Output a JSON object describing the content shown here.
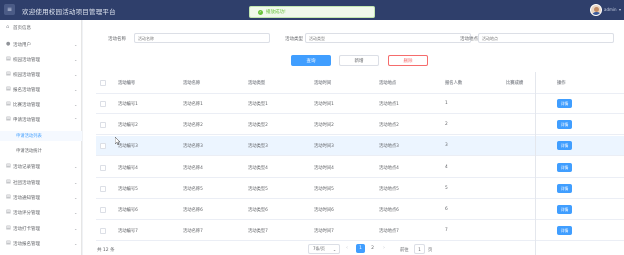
{
  "header": {
    "title": "欢迎使用校园活动项目管理平台",
    "user_name": "admin",
    "menu_icon": "menu-icon",
    "bg_color": "#2f3f6b"
  },
  "toast": {
    "message": "播放成功!",
    "type": "success",
    "color": "#67c23a"
  },
  "sidebar": {
    "items": [
      {
        "label": "首页信息",
        "icon": "home-icon",
        "has_caret": false
      },
      {
        "label": "活动用户",
        "icon": "user-icon",
        "has_caret": true
      },
      {
        "label": "校园活动管理",
        "icon": "list-icon",
        "has_caret": true
      },
      {
        "label": "校园活动管理",
        "icon": "list-icon",
        "has_caret": true
      },
      {
        "label": "报名活动管理",
        "icon": "list-icon",
        "has_caret": true
      },
      {
        "label": "比赛活动管理",
        "icon": "list-icon",
        "has_caret": true
      },
      {
        "label": "申请活动管理",
        "icon": "list-icon",
        "has_caret": true,
        "expanded": true
      },
      {
        "label": "申请活动列表",
        "sub": true,
        "active": true
      },
      {
        "label": "申请活动统计",
        "sub": true,
        "active": false
      },
      {
        "label": "活动记录管理",
        "icon": "list-icon",
        "has_caret": true
      },
      {
        "label": "社团活动管理",
        "icon": "list-icon",
        "has_caret": true
      },
      {
        "label": "活动通知管理",
        "icon": "list-icon",
        "has_caret": true
      },
      {
        "label": "活动评分管理",
        "icon": "list-icon",
        "has_caret": true
      },
      {
        "label": "活动打卡管理",
        "icon": "list-icon",
        "has_caret": true
      },
      {
        "label": "活动报名管理",
        "icon": "list-icon",
        "has_caret": true
      }
    ]
  },
  "filters": {
    "fields": [
      {
        "label": "活动名称",
        "placeholder": "活动名称"
      },
      {
        "label": "活动类型",
        "placeholder": "活动类型"
      },
      {
        "label": "活动地点",
        "placeholder": "活动地点"
      }
    ]
  },
  "actions": {
    "search": "查询",
    "add": "新增",
    "delete": "删除"
  },
  "table": {
    "columns": [
      "活动编号",
      "活动名称",
      "活动类型",
      "活动时间",
      "活动地点",
      "报名人数",
      "比赛成绩",
      "操作"
    ],
    "rows": [
      [
        "活动编号1",
        "活动名称1",
        "活动类型1",
        "活动时间1",
        "活动地点1",
        "1",
        "",
        "详情"
      ],
      [
        "活动编号2",
        "活动名称2",
        "活动类型2",
        "活动时间2",
        "活动地点2",
        "2",
        "",
        "详情"
      ],
      [
        "活动编号3",
        "活动名称3",
        "活动类型3",
        "活动时间3",
        "活动地点3",
        "3",
        "",
        "详情"
      ],
      [
        "活动编号4",
        "活动名称4",
        "活动类型4",
        "活动时间4",
        "活动地点4",
        "4",
        "",
        "详情"
      ],
      [
        "活动编号5",
        "活动名称5",
        "活动类型5",
        "活动时间5",
        "活动地点5",
        "5",
        "",
        "详情"
      ],
      [
        "活动编号6",
        "活动名称6",
        "活动类型6",
        "活动时间6",
        "活动地点6",
        "6",
        "",
        "详情"
      ],
      [
        "活动编号7",
        "活动名称7",
        "活动类型7",
        "活动时间7",
        "活动地点7",
        "7",
        "",
        "详情"
      ]
    ],
    "hover_row_index": 2
  },
  "pagination": {
    "total_text": "共 12 条",
    "page_size_text": "7条/页",
    "pages": [
      "1",
      "2"
    ],
    "current_page": "1",
    "goto_prefix": "前往",
    "goto_value": "1",
    "goto_suffix": "页",
    "accent": "#409eff"
  }
}
